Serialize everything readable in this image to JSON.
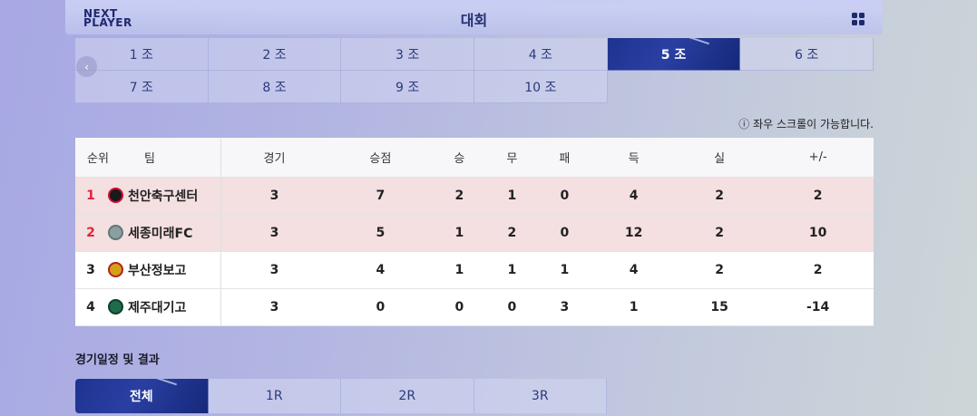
{
  "header": {
    "logo_line1": "NEXT",
    "logo_line2": "PLAYER",
    "title": "대회"
  },
  "groups": [
    "1 조",
    "2 조",
    "3 조",
    "4 조",
    "5 조",
    "6 조",
    "7 조",
    "8 조",
    "9 조",
    "10 조"
  ],
  "active_group": "5 조",
  "scroll_hint": "ⓘ 좌우 스크롤이 가능합니다.",
  "standings": {
    "columns": [
      "순위",
      "팀",
      "경기",
      "승점",
      "승",
      "무",
      "패",
      "득",
      "실",
      "+/-"
    ],
    "rows": [
      {
        "rank": "1",
        "team": "천안축구센터",
        "played": "3",
        "points": "7",
        "win": "2",
        "draw": "1",
        "loss": "0",
        "gf": "4",
        "ga": "2",
        "gd": "2"
      },
      {
        "rank": "2",
        "team": "세종미래FC",
        "played": "3",
        "points": "5",
        "win": "1",
        "draw": "2",
        "loss": "0",
        "gf": "12",
        "ga": "2",
        "gd": "10"
      },
      {
        "rank": "3",
        "team": "부산정보고",
        "played": "3",
        "points": "4",
        "win": "1",
        "draw": "1",
        "loss": "1",
        "gf": "4",
        "ga": "2",
        "gd": "2"
      },
      {
        "rank": "4",
        "team": "제주대기고",
        "played": "3",
        "points": "0",
        "win": "0",
        "draw": "0",
        "loss": "3",
        "gf": "1",
        "ga": "15",
        "gd": "-14"
      }
    ]
  },
  "schedule": {
    "title": "경기일정 및 결과",
    "rounds": [
      "전체",
      "1R",
      "2R",
      "3R"
    ],
    "active_round": "전체"
  },
  "colors": {
    "accent": "#1e3390",
    "highlight_row": "#f4dfe1",
    "red": "#e0243a"
  },
  "icons": {
    "menu": "grid-icon",
    "prev": "chevron-left-icon"
  }
}
